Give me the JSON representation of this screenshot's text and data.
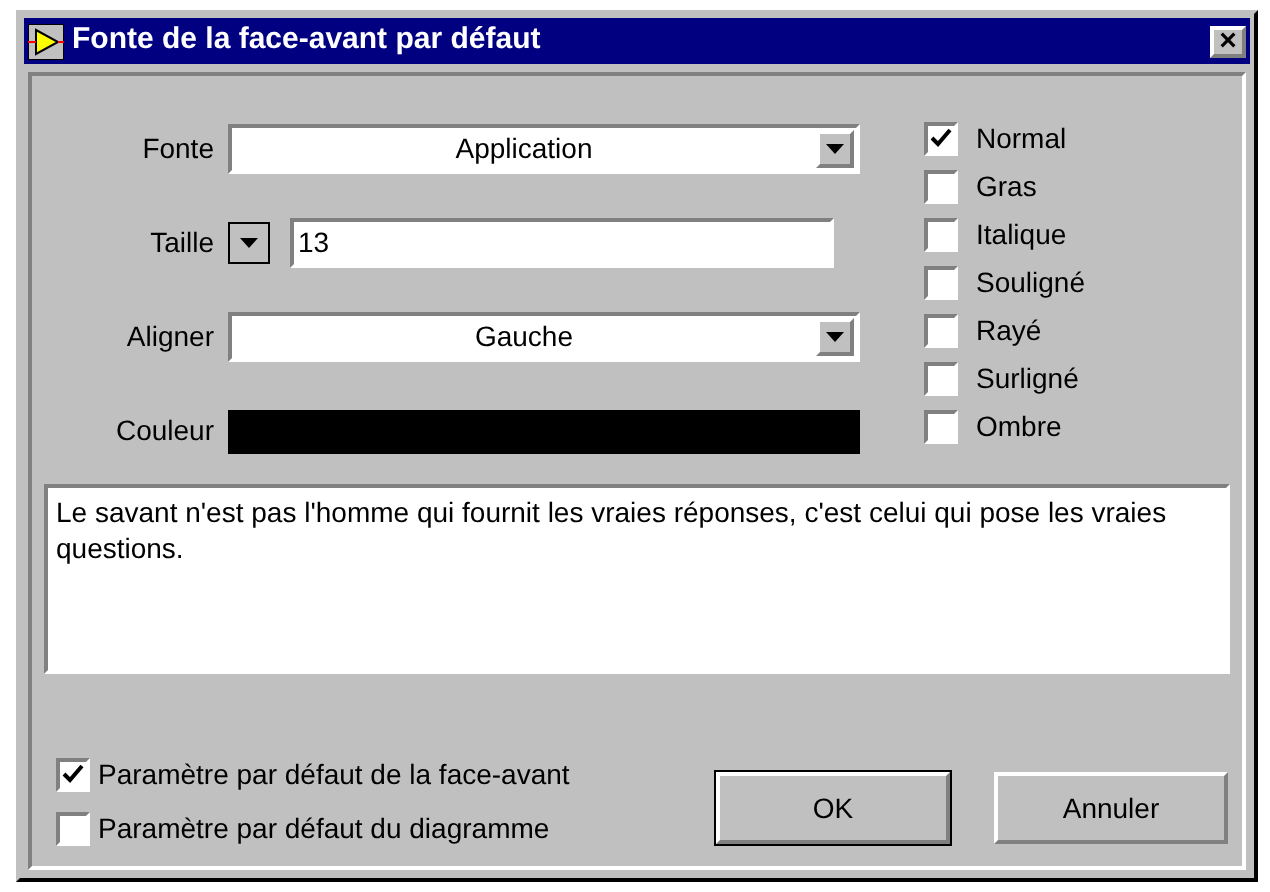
{
  "window": {
    "title": "Fonte de la face-avant par défaut",
    "close": "×"
  },
  "fields": [
    {
      "kind": "dropdown",
      "label": "Fonte",
      "value": "Application"
    },
    {
      "kind": "size",
      "label": "Taille",
      "value": "13"
    },
    {
      "kind": "dropdown",
      "label": "Aligner",
      "value": "Gauche"
    },
    {
      "kind": "color",
      "label": "Couleur",
      "color": "#000000"
    }
  ],
  "styles": [
    {
      "label": "Normal",
      "checked": true
    },
    {
      "label": "Gras",
      "checked": false
    },
    {
      "label": "Italique",
      "checked": false
    },
    {
      "label": "Souligné",
      "checked": false
    },
    {
      "label": "Rayé",
      "checked": false
    },
    {
      "label": "Surligné",
      "checked": false
    },
    {
      "label": "Ombre",
      "checked": false
    }
  ],
  "sample_text": "Le savant n'est pas l'homme qui fournit les vraies réponses, c'est celui qui pose les vraies questions.",
  "defaults": [
    {
      "label": "Paramètre par défaut de la face-avant",
      "checked": true
    },
    {
      "label": "Paramètre par défaut du diagramme",
      "checked": false
    }
  ],
  "buttons": [
    {
      "label": "OK",
      "default": true
    },
    {
      "label": "Annuler",
      "default": false
    }
  ]
}
